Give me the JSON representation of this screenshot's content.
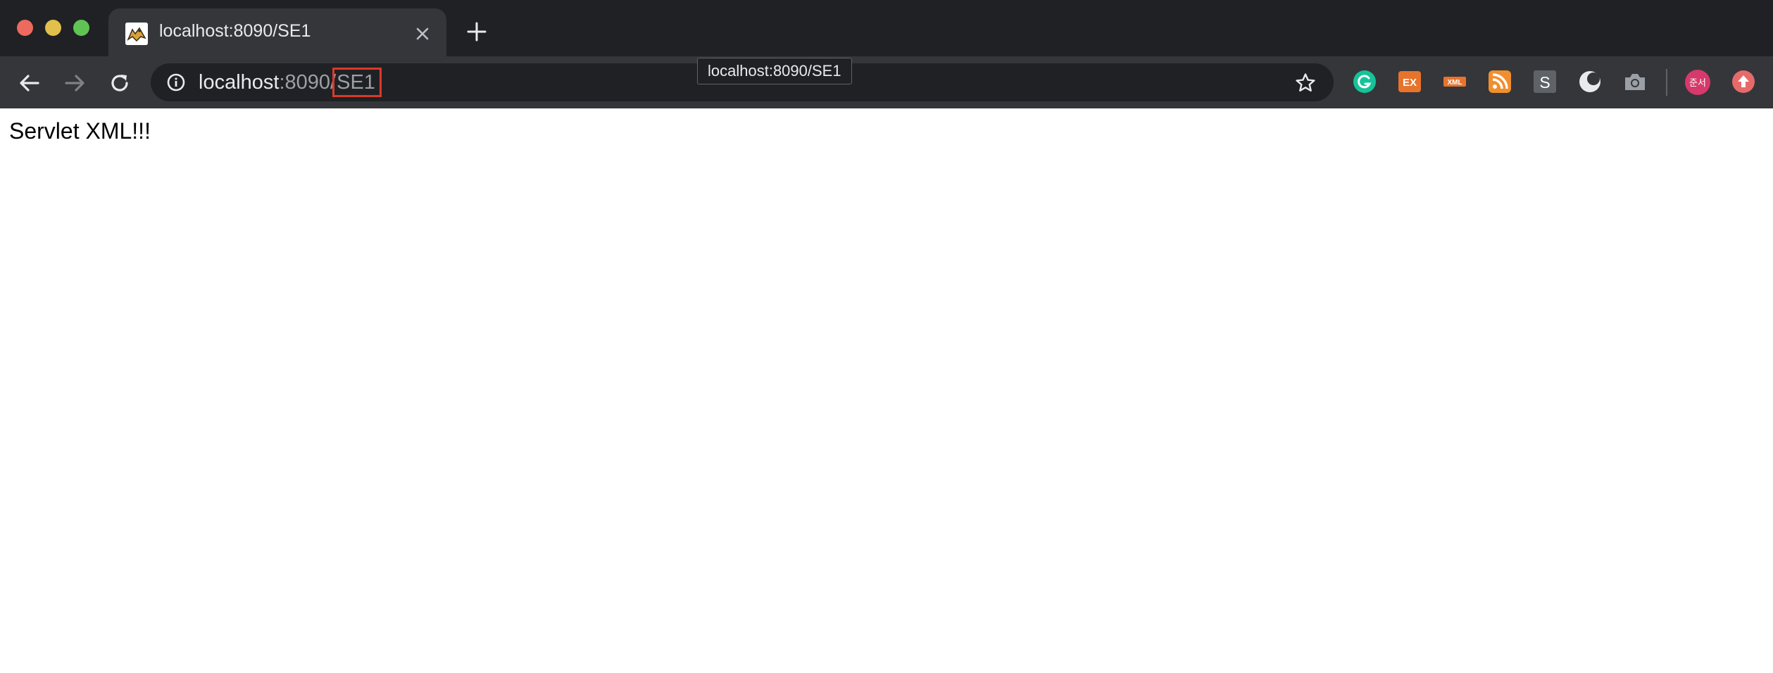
{
  "window": {
    "controls": [
      "close",
      "minimize",
      "maximize"
    ]
  },
  "tab": {
    "title": "localhost:8090/SE1",
    "favicon": "tomcat-icon"
  },
  "toolbar": {
    "back_icon": "arrow-left-icon",
    "forward_icon": "arrow-right-icon",
    "reload_icon": "reload-icon"
  },
  "omnibox": {
    "host": "localhost",
    "port": ":8090/",
    "path": "SE1",
    "highlight_color": "#d93a2b"
  },
  "tooltip": {
    "text": "localhost:8090/SE1"
  },
  "extensions": {
    "ex_label": "EX",
    "xml_label": "XML",
    "s_label": "S",
    "avatar_label": "준서"
  },
  "page": {
    "body_text": "Servlet XML!!!"
  },
  "colors": {
    "chrome_dark": "#202124",
    "toolbar": "#35363a",
    "grammarly": "#15c39a",
    "ex_orange": "#e8742c",
    "rss_orange": "#f18f2e",
    "avatar_pink": "#d6396b",
    "upload_salmon": "#e76a6a"
  }
}
